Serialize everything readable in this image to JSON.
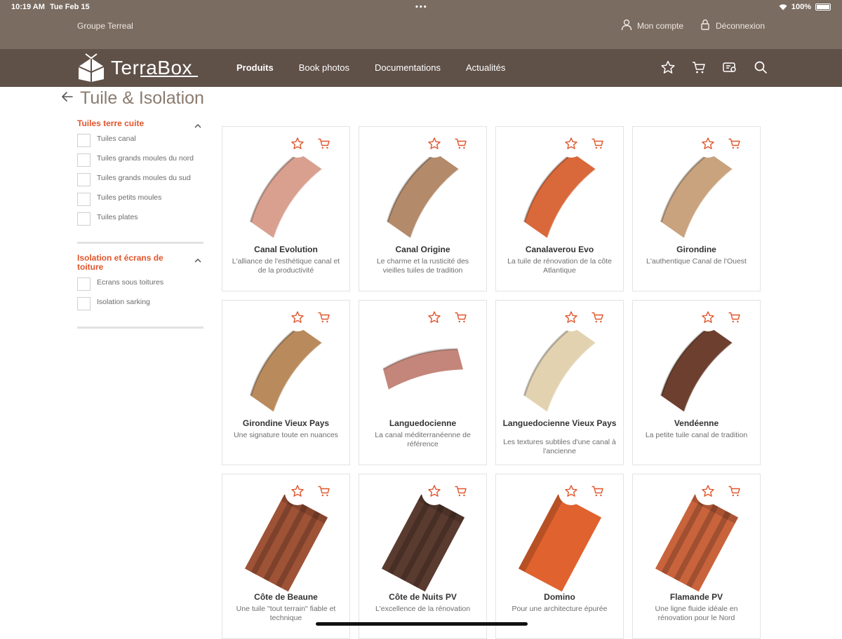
{
  "status": {
    "time": "10:19 AM",
    "date": "Tue Feb 15",
    "battery": "100%"
  },
  "header": {
    "group": "Groupe Terreal",
    "account": "Mon compte",
    "logout": "Déconnexion"
  },
  "nav": {
    "logo_terra": "Terra",
    "logo_box": "Box",
    "links": [
      "Produits",
      "Book photos",
      "Documentations",
      "Actualités"
    ]
  },
  "page": {
    "title": "Tuile & Isolation"
  },
  "sidebar": {
    "facets": [
      {
        "title": "Tuiles terre cuite",
        "options": [
          "Tuiles canal",
          "Tuiles grands moules du nord",
          "Tuiles grands moules du sud",
          "Tuiles petits moules",
          "Tuiles plates"
        ]
      },
      {
        "title": "Isolation et écrans de toiture",
        "options": [
          "Ecrans sous toitures",
          "Isolation sarking"
        ]
      }
    ]
  },
  "products": [
    {
      "name": "Canal Evolution",
      "desc": "L'alliance de l'esthétique canal et de la productivité",
      "color": "#d9a08f",
      "shape": "canal"
    },
    {
      "name": "Canal Origine",
      "desc": "Le charme et la rusticité des vieilles tuiles de tradition",
      "color": "#b38a6a",
      "shape": "canal"
    },
    {
      "name": "Canalaverou Evo",
      "desc": "La tuile de rénovation de la côte Atlantique",
      "color": "#d9683a",
      "shape": "canal"
    },
    {
      "name": "Girondine",
      "desc": "L'authentique Canal de l'Ouest",
      "color": "#c9a27e",
      "shape": "canal"
    },
    {
      "name": "Girondine Vieux Pays",
      "desc": "Une signature toute en nuances",
      "color": "#b98a5c",
      "shape": "canal"
    },
    {
      "name": "Languedocienne",
      "desc": "La canal méditerranéenne de référence",
      "color": "#c4867a",
      "shape": "flatcanal"
    },
    {
      "name": "Languedocienne Vieux Pays",
      "desc": "Les textures subtiles d'une canal à l'ancienne",
      "color": "#e2d2b0",
      "shape": "canal"
    },
    {
      "name": "Vendéenne",
      "desc": "La petite tuile canal de tradition",
      "color": "#6d3f2e",
      "shape": "canal"
    },
    {
      "name": "Côte de Beaune",
      "desc": "Une tuile \"tout terrain\" fiable et technique",
      "color": "#9e5236",
      "shape": "ridged"
    },
    {
      "name": "Côte de Nuits PV",
      "desc": "L'excellence de la rénovation",
      "color": "#5a3b30",
      "shape": "ridged"
    },
    {
      "name": "Domino",
      "desc": "Pour une architecture épurée",
      "color": "#e0622e",
      "shape": "flat"
    },
    {
      "name": "Flamande PV",
      "desc": "Une ligne fluide idéale en rénovation pour le Nord",
      "color": "#c9633c",
      "shape": "ridged"
    }
  ],
  "colors": {
    "accent": "#e0552c",
    "topband": "#7a6c61",
    "navbar": "#5f5048"
  },
  "icons": [
    "person-icon",
    "lock-icon",
    "star-icon",
    "cart-icon",
    "catalog-icon",
    "search-icon",
    "arrow-left-icon",
    "chevron-up-icon"
  ]
}
